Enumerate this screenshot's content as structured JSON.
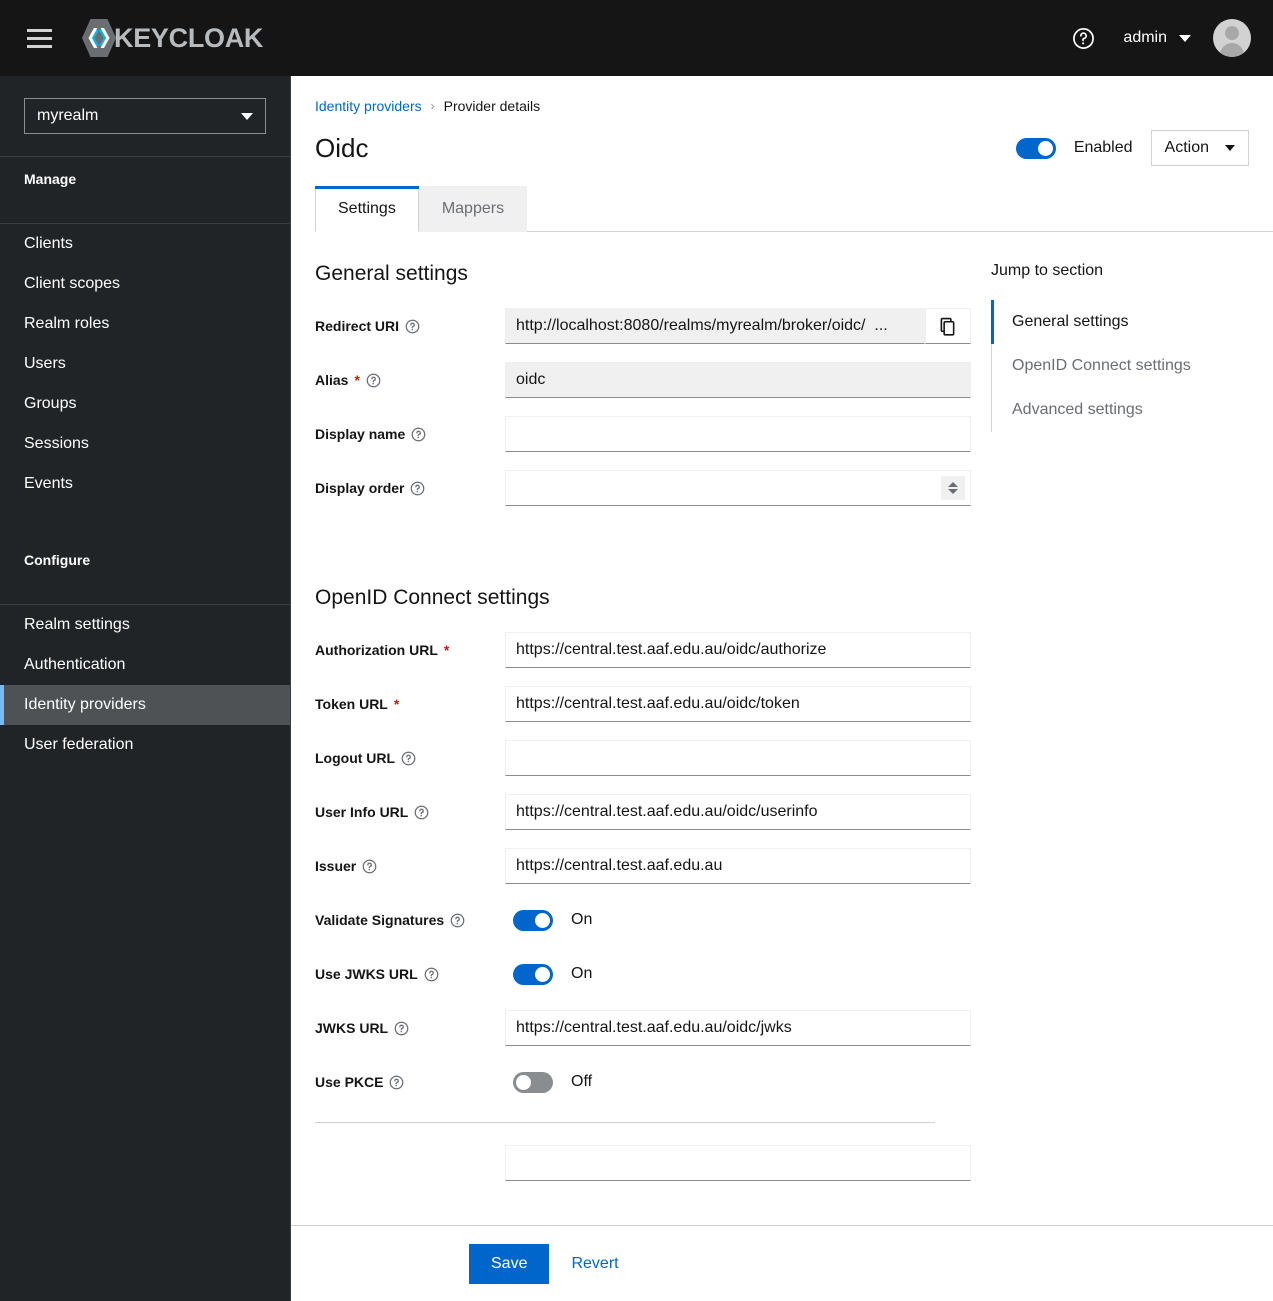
{
  "masthead": {
    "hamburger_icon": "hamburger-menu-icon",
    "brand": "KEYCLOAK",
    "help_icon": "help-circle-icon",
    "username": "admin",
    "avatar_icon": "user-avatar-icon"
  },
  "sidebar": {
    "realm": "myrealm",
    "groups": [
      {
        "title": "Manage",
        "items": [
          "Clients",
          "Client scopes",
          "Realm roles",
          "Users",
          "Groups",
          "Sessions",
          "Events"
        ]
      },
      {
        "title": "Configure",
        "items": [
          "Realm settings",
          "Authentication",
          "Identity providers",
          "User federation"
        ]
      }
    ],
    "active_item": "Identity providers"
  },
  "breadcrumb": {
    "parent": "Identity providers",
    "separator": "›",
    "current": "Provider details"
  },
  "header": {
    "title": "Oidc",
    "enabled_label": "Enabled",
    "enabled_state": "on",
    "action_label": "Action"
  },
  "tabs": [
    {
      "label": "Settings",
      "active": true
    },
    {
      "label": "Mappers",
      "active": false
    }
  ],
  "general_settings": {
    "heading": "General settings",
    "redirect_uri": {
      "label": "Redirect URI",
      "value": "http://localhost:8080/realms/myrealm/broker/oidc/  ...",
      "copy_icon": "copy-icon",
      "readonly": true
    },
    "alias": {
      "label": "Alias",
      "required": true,
      "value": "oidc",
      "readonly": true
    },
    "display_name": {
      "label": "Display name",
      "value": "",
      "placeholder": ""
    },
    "display_order": {
      "label": "Display order",
      "value": "",
      "placeholder": ""
    }
  },
  "oidc_settings": {
    "heading": "OpenID Connect settings",
    "authorization_url": {
      "label": "Authorization URL",
      "required": true,
      "value": "https://central.test.aaf.edu.au/oidc/authorize"
    },
    "token_url": {
      "label": "Token URL",
      "required": true,
      "value": "https://central.test.aaf.edu.au/oidc/token"
    },
    "logout_url": {
      "label": "Logout URL",
      "value": "",
      "placeholder": ""
    },
    "user_info_url": {
      "label": "User Info URL",
      "value": "https://central.test.aaf.edu.au/oidc/userinfo"
    },
    "issuer": {
      "label": "Issuer",
      "value": "https://central.test.aaf.edu.au"
    },
    "validate_signatures": {
      "label": "Validate Signatures",
      "state": "on",
      "state_label": "On"
    },
    "use_jwks_url": {
      "label": "Use JWKS URL",
      "state": "on",
      "state_label": "On"
    },
    "jwks_url": {
      "label": "JWKS URL",
      "value": "https://central.test.aaf.edu.au/oidc/jwks"
    },
    "use_pkce": {
      "label": "Use PKCE",
      "state": "off",
      "state_label": "Off"
    }
  },
  "jump_to_section": {
    "title": "Jump to section",
    "items": [
      {
        "label": "General settings",
        "active": true
      },
      {
        "label": "OpenID Connect settings",
        "active": false
      },
      {
        "label": "Advanced settings",
        "active": false
      }
    ]
  },
  "action_bar": {
    "save_label": "Save",
    "revert_label": "Revert"
  },
  "colors": {
    "accent": "#0066cc",
    "masthead_bg": "#151515",
    "sidebar_bg": "#212427",
    "active_nav_bg": "#4f5255",
    "active_nav_bar": "#73bcf7",
    "required_star": "#c9190b",
    "toggle_off": "#8a8d90"
  }
}
